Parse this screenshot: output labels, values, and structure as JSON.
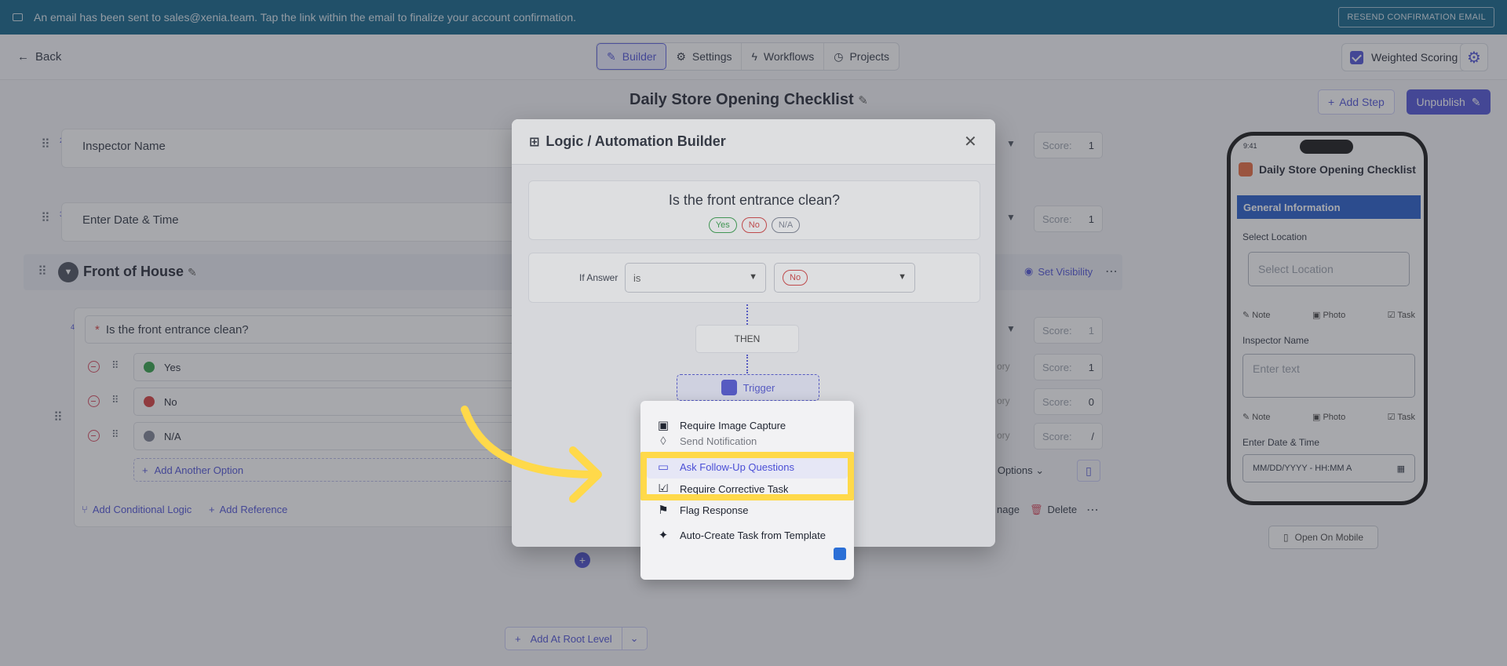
{
  "banner": {
    "message": "An email has been sent to sales@xenia.team. Tap the link within the email to finalize your account confirmation.",
    "resend_label": "RESEND CONFIRMATION EMAIL"
  },
  "header": {
    "back_label": "Back",
    "tabs": [
      {
        "label": "Builder",
        "icon": "edit-icon"
      },
      {
        "label": "Settings",
        "icon": "gear-icon"
      },
      {
        "label": "Workflows",
        "icon": "bolt-icon"
      },
      {
        "label": "Projects",
        "icon": "clock-icon"
      }
    ],
    "weighted_scoring_label": "Weighted Scoring"
  },
  "title_row": {
    "title": "Daily Store Opening Checklist",
    "add_step_label": "Add Step",
    "unpublish_label": "Unpublish"
  },
  "builder": {
    "questions": [
      {
        "number": "2",
        "label": "Inspector Name",
        "score_label": "Score:",
        "score": "1"
      },
      {
        "number": "3",
        "label": "Enter Date & Time",
        "score_label": "Score:",
        "score": "1"
      }
    ],
    "section": {
      "title": "Front of House",
      "set_visibility_label": "Set Visibility"
    },
    "question4": {
      "number": "4",
      "required_mark": "*",
      "label": "Is the front entrance clean?",
      "score_label": "Score:",
      "score": "1",
      "options": [
        {
          "label": "Yes",
          "color": "#2f9e44",
          "score": "1",
          "tag": "ory"
        },
        {
          "label": "No",
          "color": "#d63a3a",
          "score": "0",
          "tag": "ory"
        },
        {
          "label": "N/A",
          "color": "#7a8090",
          "score": "/",
          "tag": "ory"
        }
      ],
      "add_option_label": "Add Another Option",
      "d_options_label": "d Options",
      "add_logic_label": "Add Conditional Logic",
      "add_reference_label": "Add Reference",
      "image_label": "nage",
      "delete_label": "Delete"
    },
    "add_root_label": "Add At Root Level"
  },
  "phone": {
    "time": "9:41",
    "title": "Daily Store Opening Checklist",
    "section": "General Information",
    "fields": [
      {
        "label": "Select Location",
        "placeholder": "Select Location"
      },
      {
        "label": "Inspector Name",
        "placeholder": "Enter text"
      },
      {
        "label": "Enter Date & Time",
        "placeholder": "MM/DD/YYYY - HH:MM A"
      }
    ],
    "actions": [
      "Note",
      "Photo",
      "Task"
    ],
    "open_mobile_label": "Open On Mobile"
  },
  "modal": {
    "title": "Logic / Automation Builder",
    "question": "Is the front entrance clean?",
    "chips": [
      {
        "label": "Yes",
        "color": "#2f9e44"
      },
      {
        "label": "No",
        "color": "#d63a3a"
      },
      {
        "label": "N/A",
        "color": "#7a8090"
      }
    ],
    "if_answer_label": "If Answer",
    "operator": "is",
    "answer": "No",
    "then_label": "THEN",
    "trigger_label": "Trigger"
  },
  "menu": {
    "items": [
      {
        "label": "Require Image Capture",
        "icon": "image-icon"
      },
      {
        "label": "Send Notification",
        "icon": "bell-icon"
      },
      {
        "label": "Ask Follow-Up Questions",
        "icon": "chat-icon"
      },
      {
        "label": "Require Corrective Task",
        "icon": "task-icon"
      },
      {
        "label": "Flag Response",
        "icon": "flag-icon"
      },
      {
        "label": "Auto-Create Task from Template",
        "icon": "magic-wand-icon"
      }
    ]
  },
  "colors": {
    "accent": "#4b4fd6",
    "highlight": "#ffd94a",
    "banner": "#0b5f86"
  }
}
